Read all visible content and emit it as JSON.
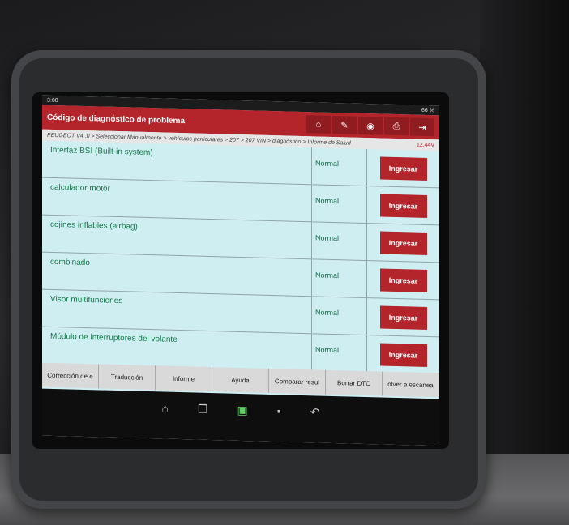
{
  "statusbar": {
    "time": "3:08",
    "battery": "66 %"
  },
  "header": {
    "title": "Código de diagnóstico de problema",
    "buttons": [
      {
        "name": "home-icon",
        "glyph": "⌂"
      },
      {
        "name": "report-icon",
        "glyph": "✎"
      },
      {
        "name": "chat-icon",
        "glyph": "◉"
      },
      {
        "name": "print-icon",
        "glyph": "⎙"
      },
      {
        "name": "exit-icon",
        "glyph": "⇥"
      }
    ]
  },
  "breadcrumb": {
    "path": "PEUGEOT V4 .0 > Seleccionar Manualmente > vehículos particulares > 207 > 207 VIN > diagnóstico > Informe de Salud",
    "voltage": "12.44V"
  },
  "systems": [
    {
      "name": "Interfaz BSI (Built-in system)",
      "status": "Normal",
      "action": "Ingresar"
    },
    {
      "name": "calculador motor",
      "status": "Normal",
      "action": "Ingresar"
    },
    {
      "name": "cojines inflables (airbag)",
      "status": "Normal",
      "action": "Ingresar"
    },
    {
      "name": "combinado",
      "status": "Normal",
      "action": "Ingresar"
    },
    {
      "name": "Visor multifunciones",
      "status": "Normal",
      "action": "Ingresar"
    },
    {
      "name": "Módulo de interruptores del volante",
      "status": "Normal",
      "action": "Ingresar"
    }
  ],
  "bottombar": [
    "Corrección de e",
    "Traducción",
    "Informe",
    "Ayuda",
    "Comparar resul",
    "Borrar DTC",
    "olver a escanea"
  ],
  "navbar": [
    {
      "name": "nav-home-icon",
      "glyph": "⌂"
    },
    {
      "name": "nav-recent-icon",
      "glyph": "❐"
    },
    {
      "name": "nav-vci-icon",
      "glyph": "▣"
    },
    {
      "name": "nav-screenshot-icon",
      "glyph": "▪"
    },
    {
      "name": "nav-back-icon",
      "glyph": "↶"
    }
  ]
}
